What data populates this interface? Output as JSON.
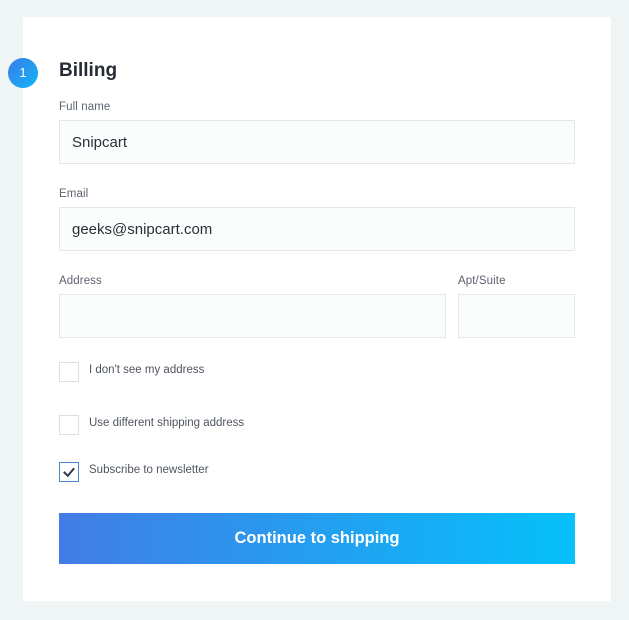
{
  "billing": {
    "step_number": "1",
    "title": "Billing",
    "fields": {
      "full_name": {
        "label": "Full name",
        "value": "Snipcart"
      },
      "email": {
        "label": "Email",
        "value": "geeks@snipcart.com"
      },
      "address": {
        "label": "Address",
        "value": ""
      },
      "apt_suite": {
        "label": "Apt/Suite",
        "value": ""
      }
    },
    "checkboxes": [
      {
        "label": "I don't see my address",
        "checked": false
      },
      {
        "label": "Use different shipping address",
        "checked": false
      },
      {
        "label": "Subscribe to newsletter",
        "checked": true
      }
    ],
    "continue_label": "Continue to shipping"
  },
  "colors": {
    "accent_gradient_start": "#437ce6",
    "accent_gradient_end": "#06c0fa",
    "page_background": "#eff4f4",
    "card_background": "#ffffff",
    "checkmark": "#2f3a4a"
  }
}
